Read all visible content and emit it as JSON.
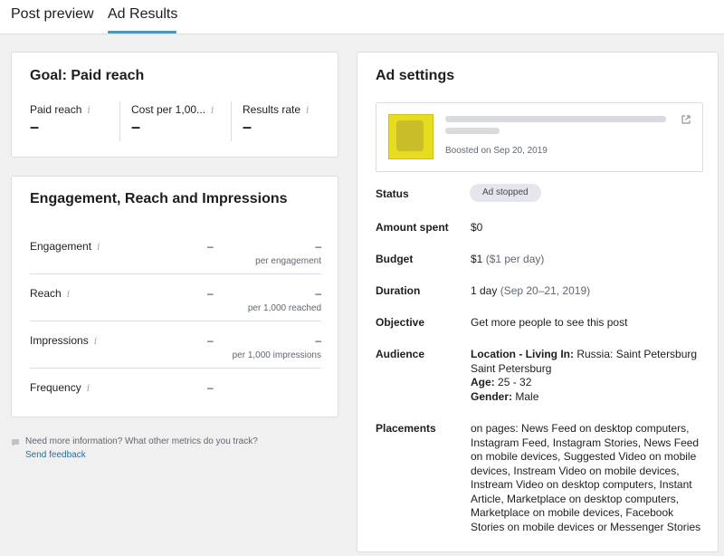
{
  "tabs": [
    {
      "label": "Post preview",
      "active": false
    },
    {
      "label": "Ad Results",
      "active": true
    }
  ],
  "goal": {
    "title": "Goal: Paid reach",
    "metrics": [
      {
        "label": "Paid reach",
        "value": "–"
      },
      {
        "label": "Cost per 1,00...",
        "value": "–"
      },
      {
        "label": "Results rate",
        "value": "–"
      }
    ]
  },
  "engagement": {
    "title": "Engagement, Reach and Impressions",
    "rows": [
      {
        "label": "Engagement",
        "value": "–",
        "cost": "–",
        "sub": "per engagement"
      },
      {
        "label": "Reach",
        "value": "–",
        "cost": "–",
        "sub": "per 1,000 reached"
      },
      {
        "label": "Impressions",
        "value": "–",
        "cost": "–",
        "sub": "per 1,000 impressions"
      },
      {
        "label": "Frequency",
        "value": "–"
      }
    ]
  },
  "feedback": {
    "question": "Need more information? What other metrics do you track?",
    "link": "Send feedback"
  },
  "ad_settings": {
    "title": "Ad settings",
    "post": {
      "boosted": "Boosted on Sep 20, 2019"
    },
    "status_label": "Status",
    "status_badge": "Ad stopped",
    "amount_label": "Amount spent",
    "amount_value": "$0",
    "budget_label": "Budget",
    "budget_value": "$1",
    "budget_detail": "($1 per day)",
    "duration_label": "Duration",
    "duration_value": "1 day",
    "duration_detail": "(Sep 20–21, 2019)",
    "objective_label": "Objective",
    "objective_value": "Get more people to see this post",
    "audience_label": "Audience",
    "audience_location_key": "Location - Living In:",
    "audience_location_val": "Russia: Saint Petersburg",
    "audience_location_val2": "Saint Petersburg",
    "audience_age_key": "Age:",
    "audience_age_val": "25 - 32",
    "audience_gender_key": "Gender:",
    "audience_gender_val": "Male",
    "placements_label": "Placements",
    "placements_value": "on pages: News Feed on desktop computers, Instagram Feed, Instagram Stories, News Feed on mobile devices, Suggested Video on mobile devices, Instream Video on mobile devices, Instream Video on desktop computers, Instant Article, Marketplace on desktop computers, Marketplace on mobile devices, Facebook Stories on mobile devices or Messenger Stories"
  },
  "colors": {
    "accent": "#4f95b8",
    "link": "#2a6f94",
    "thumbnail": "#e8dc1f"
  }
}
